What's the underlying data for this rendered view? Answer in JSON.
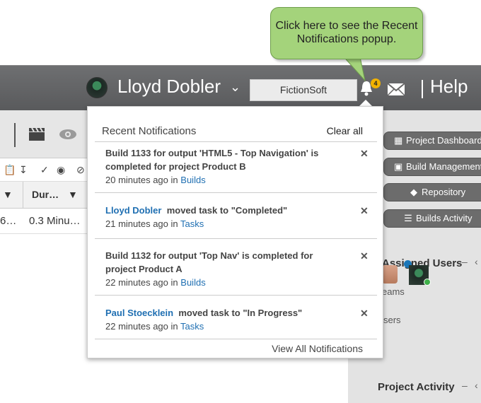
{
  "callout": {
    "line1": "Click here to see the Recent",
    "line2": "Notifications popup."
  },
  "header": {
    "user_name": "Lloyd Dobler",
    "company": "FictionSoft",
    "notification_count": "4",
    "help_label": "Help"
  },
  "table": {
    "headers": [
      "Dur…"
    ],
    "row": {
      "c1": "6…",
      "c2": "0.3 Minu…"
    }
  },
  "popup": {
    "title": "Recent Notifications",
    "clear_label": "Clear all",
    "view_all_label": "View All Notifications",
    "items": [
      {
        "message": "Build 1133 for output 'HTML5 - Top Navigation' is completed for project Product B",
        "time": "20 minutes ago",
        "in": "in",
        "link": "Builds"
      },
      {
        "who": "Lloyd Dobler",
        "message": "moved task to \"Completed\"",
        "time": "21 minutes ago",
        "in": "in",
        "link": "Tasks"
      },
      {
        "message": "Build 1132 for output 'Top Nav' is completed for project Product A",
        "time": "22 minutes ago",
        "in": "in",
        "link": "Builds"
      },
      {
        "who": "Paul Stoecklein",
        "message": "moved task to \"In Progress\"",
        "time": "22 minutes ago",
        "in": "in",
        "link": "Tasks"
      }
    ]
  },
  "right_panel": {
    "buttons": [
      "Project Dashboard",
      "Build Management",
      "Repository",
      "Builds Activity"
    ],
    "assigned_users": "Assigned Users",
    "teams": "eams",
    "users": "sers",
    "project_activity": "Project Activity"
  }
}
